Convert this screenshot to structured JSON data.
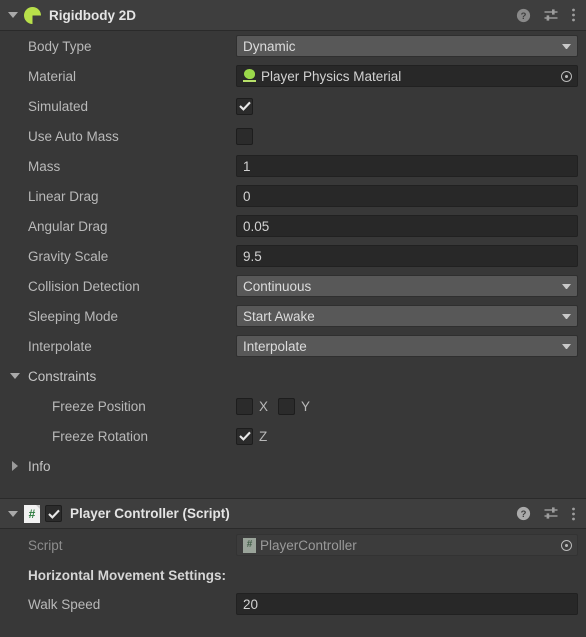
{
  "components": [
    {
      "title": "Rigidbody 2D",
      "icon": "rigidbody2d-icon",
      "expanded": true,
      "help_icon": "help-icon",
      "preset_icon": "preset-settings-icon",
      "menu_icon": "kebab-menu-icon",
      "rows": [
        {
          "label": "Body Type",
          "type": "dropdown",
          "value": "Dynamic"
        },
        {
          "label": "Material",
          "type": "object",
          "value": "Player Physics Material",
          "icon": "physics-material-icon"
        },
        {
          "label": "Simulated",
          "type": "checkbox",
          "checked": true
        },
        {
          "label": "Use Auto Mass",
          "type": "checkbox",
          "checked": false
        },
        {
          "label": "Mass",
          "type": "text",
          "value": "1"
        },
        {
          "label": "Linear Drag",
          "type": "text",
          "value": "0"
        },
        {
          "label": "Angular Drag",
          "type": "text",
          "value": "0.05"
        },
        {
          "label": "Gravity Scale",
          "type": "text",
          "value": "9.5"
        },
        {
          "label": "Collision Detection",
          "type": "dropdown",
          "value": "Continuous"
        },
        {
          "label": "Sleeping Mode",
          "type": "dropdown",
          "value": "Start Awake"
        },
        {
          "label": "Interpolate",
          "type": "dropdown",
          "value": "Interpolate"
        }
      ],
      "constraints": {
        "label": "Constraints",
        "expanded": true,
        "freeze_position": {
          "label": "Freeze Position",
          "axes": [
            {
              "name": "X",
              "checked": false
            },
            {
              "name": "Y",
              "checked": false
            }
          ]
        },
        "freeze_rotation": {
          "label": "Freeze Rotation",
          "axes": [
            {
              "name": "Z",
              "checked": true
            }
          ]
        }
      },
      "info": {
        "label": "Info",
        "expanded": false
      }
    },
    {
      "title": "Player Controller (Script)",
      "icon": "csharp-script-icon",
      "expanded": true,
      "enabled": true,
      "help_icon": "help-icon",
      "preset_icon": "preset-settings-icon",
      "menu_icon": "kebab-menu-icon",
      "script_row": {
        "label": "Script",
        "value": "PlayerController",
        "icon": "csharp-script-icon"
      },
      "section_header": "Horizontal Movement Settings:",
      "rows": [
        {
          "label": "Walk Speed",
          "type": "text",
          "value": "20"
        }
      ]
    }
  ],
  "colors": {
    "panel_bg": "#383838",
    "header_bg": "#3e3e3e",
    "field_bg": "#282828",
    "dropdown_bg": "#585858",
    "accent_green": "#b8e04a",
    "text": "#b9b9b9"
  }
}
